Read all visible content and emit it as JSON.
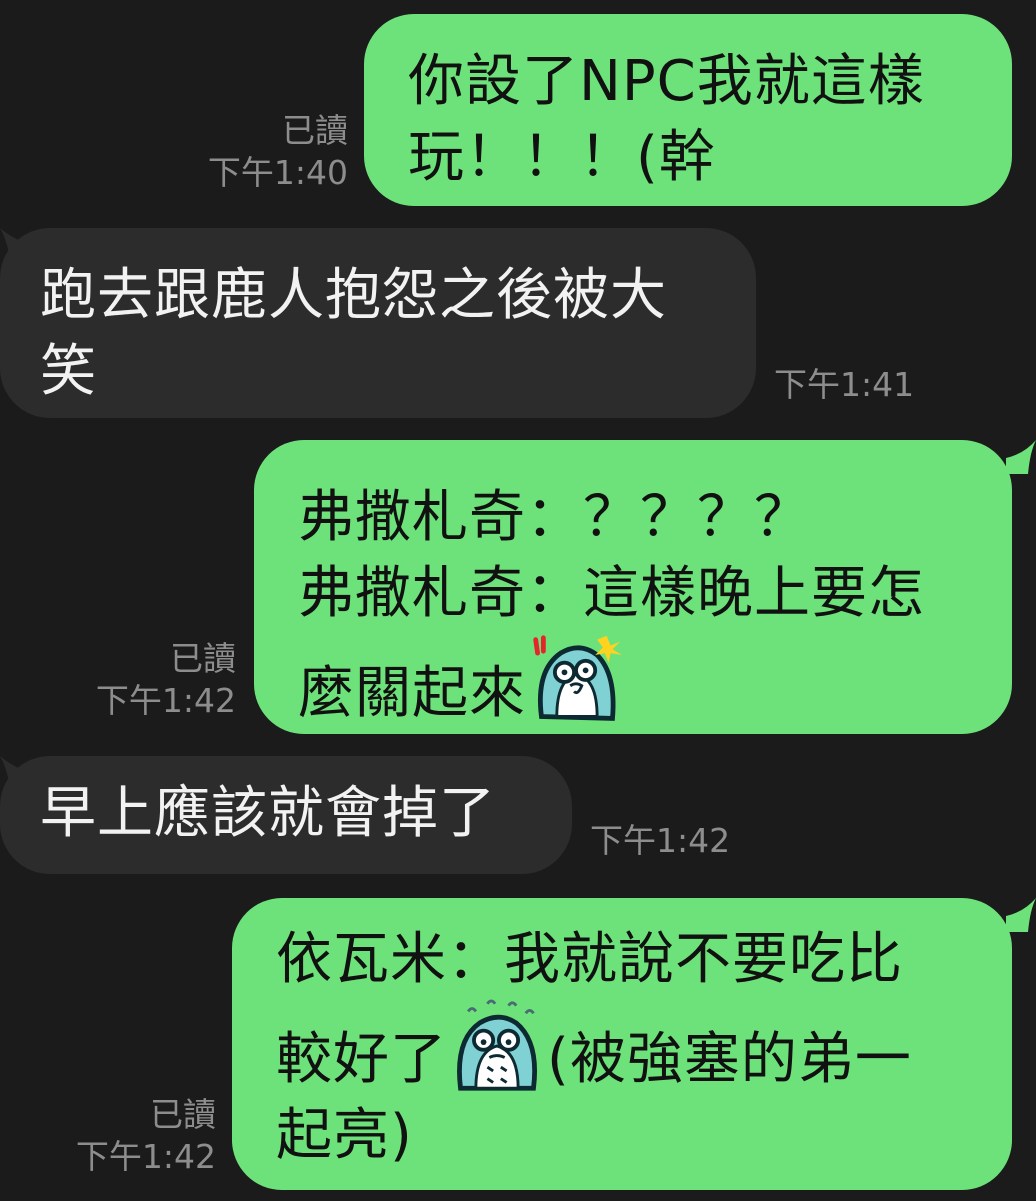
{
  "colors": {
    "background": "#1b1b1b",
    "sent_bubble": "#6ee27a",
    "received_bubble": "#2c2c2c",
    "meta_text": "#8d8d8d"
  },
  "messages": [
    {
      "direction": "sent",
      "lines": [
        "你設了NPC我就這樣",
        "玩！！！(幹"
      ],
      "read_label": "已讀",
      "time": "下午1:40"
    },
    {
      "direction": "received",
      "lines": [
        "跑去跟鹿人抱怨之後被大",
        "笑"
      ],
      "time": "下午1:41"
    },
    {
      "direction": "sent",
      "lines": [
        "弗撒札奇：？？？？",
        "弗撒札奇：這樣晚上要怎",
        "麼關起來"
      ],
      "emoji": "shocked-penguin-sticker-icon",
      "read_label": "已讀",
      "time": "下午1:42"
    },
    {
      "direction": "received",
      "lines": [
        "早上應該就會掉了"
      ],
      "time": "下午1:42"
    },
    {
      "direction": "sent",
      "lines": [
        "依瓦米：我就說不要吃比",
        "較好了",
        "(被強塞的弟一",
        "起亮)"
      ],
      "emoji": "nervous-penguin-sticker-icon",
      "read_label": "已讀",
      "time": "下午1:42"
    }
  ]
}
